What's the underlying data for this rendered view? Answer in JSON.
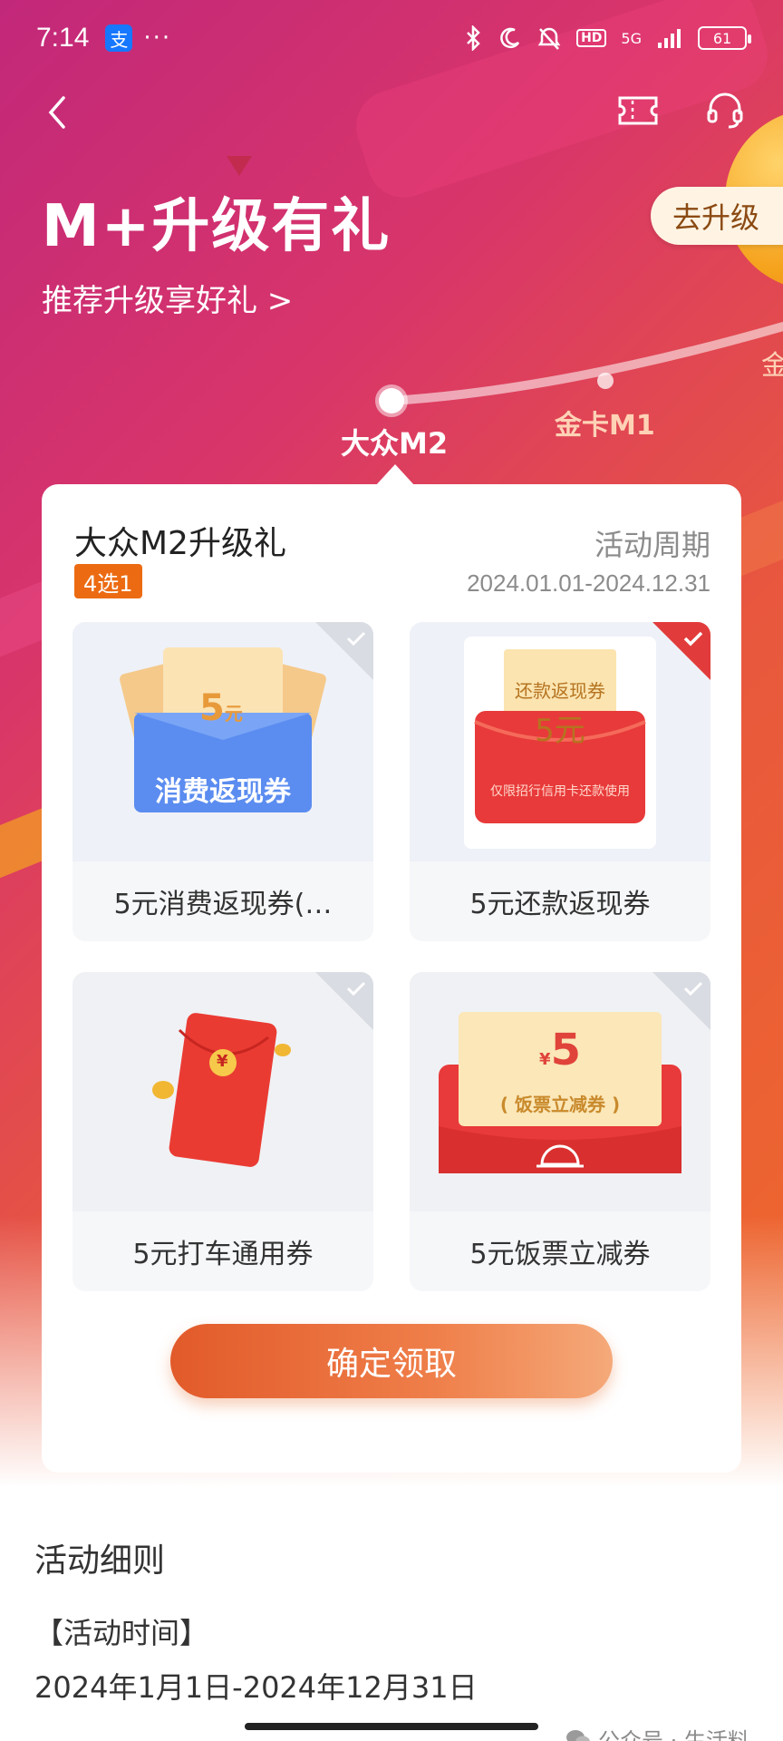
{
  "status_bar": {
    "time": "7:14",
    "app_badge": "支",
    "dots": "···",
    "network": "5G",
    "hd": "HD",
    "battery": "61"
  },
  "header": {
    "title": "M+升级有礼",
    "subtitle": "推荐升级享好礼 >",
    "upgrade_button": "去升级"
  },
  "levels": {
    "current": "大众M2",
    "next": "金卡M1",
    "partial": "金"
  },
  "card": {
    "title": "大众M2升级礼",
    "badge": "4选1",
    "period_label": "活动周期",
    "period_value": "2024.01.01-2024.12.31",
    "options": [
      {
        "label": "5元消费返现券(…",
        "thumb_amount": "5",
        "thumb_unit": "元",
        "thumb_text": "消费返现券",
        "selected": false
      },
      {
        "label": "5元还款返现券",
        "thumb_title": "还款返现券",
        "thumb_amount": "5元",
        "thumb_note": "仅限招行信用卡还款使用",
        "selected": true
      },
      {
        "label": "5元打车通用券",
        "thumb_symbol": "¥",
        "selected": false
      },
      {
        "label": "5元饭票立减券",
        "thumb_symbol": "¥",
        "thumb_amount": "5",
        "thumb_text": "( 饭票立减券 )",
        "selected": false
      }
    ],
    "confirm_button": "确定领取"
  },
  "rules": {
    "title": "活动细则",
    "time_label": "【活动时间】",
    "time_value": "2024年1月1日-2024年12月31日"
  },
  "watermark": "公众号 · 生活料",
  "colors": {
    "accent_orange": "#ec6b12",
    "selected_red": "#e23b3b",
    "hero_start": "#c2287a",
    "hero_end": "#ef6a2a"
  }
}
